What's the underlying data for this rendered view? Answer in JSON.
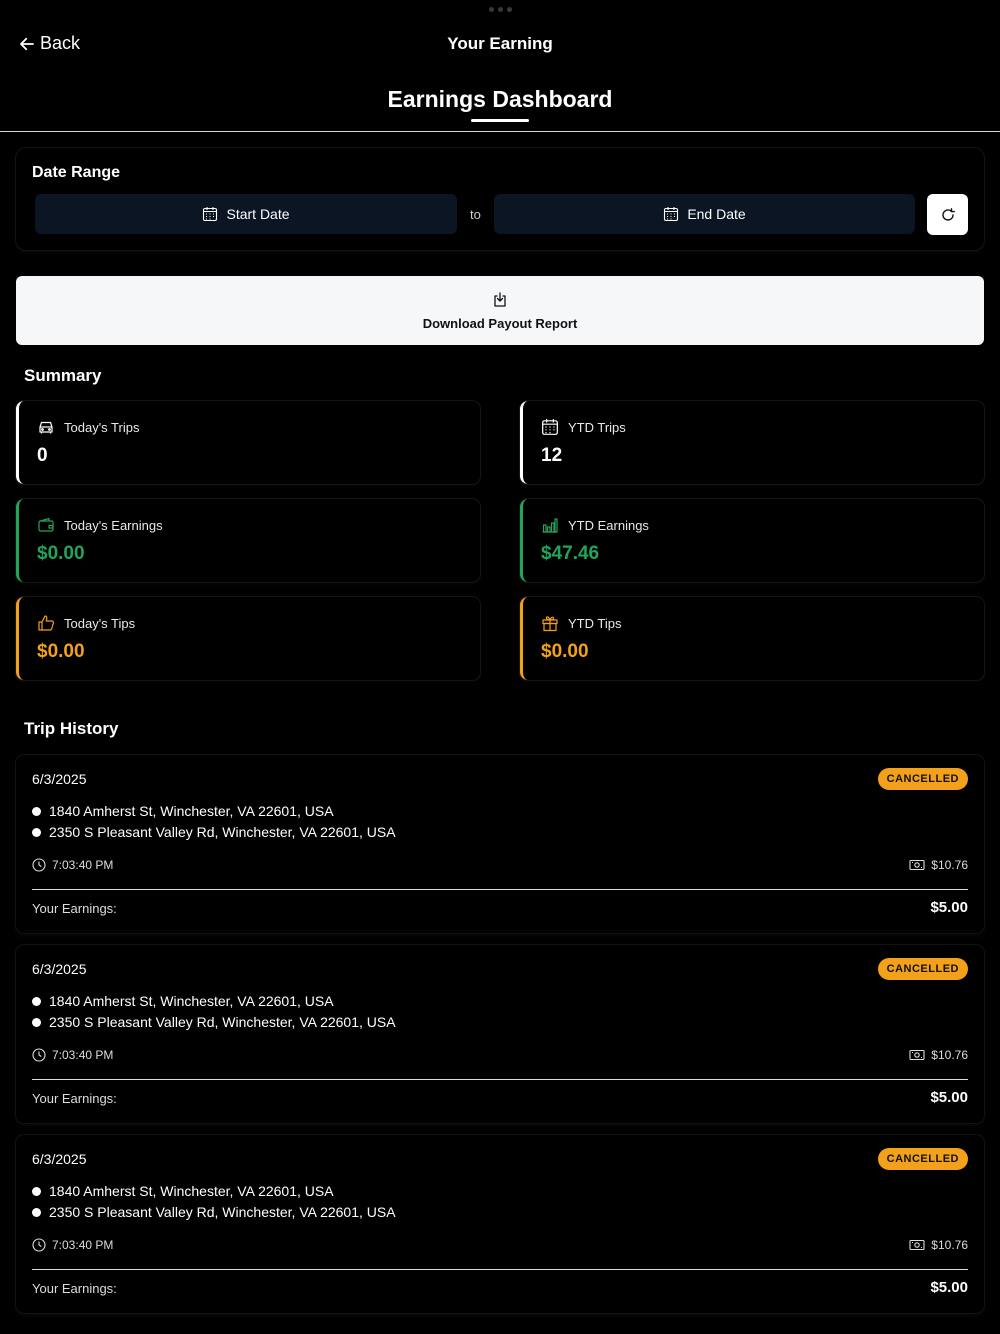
{
  "nav": {
    "back_label": "Back",
    "title": "Your Earning"
  },
  "tab": {
    "title": "Earnings Dashboard"
  },
  "date_range": {
    "label": "Date Range",
    "start_label": "Start Date",
    "to_label": "to",
    "end_label": "End Date"
  },
  "download": {
    "label": "Download Payout Report"
  },
  "summary": {
    "title": "Summary",
    "cards": [
      {
        "label": "Today's Trips",
        "value": "0",
        "icon": "car-icon"
      },
      {
        "label": "YTD Trips",
        "value": "12",
        "icon": "calendar-icon"
      },
      {
        "label": "Today's Earnings",
        "value": "$0.00",
        "icon": "wallet-icon"
      },
      {
        "label": "YTD Earnings",
        "value": "$47.46",
        "icon": "bar-chart-icon"
      },
      {
        "label": "Today's Tips",
        "value": "$0.00",
        "icon": "thumbs-up-icon"
      },
      {
        "label": "YTD Tips",
        "value": "$0.00",
        "icon": "gift-icon"
      }
    ]
  },
  "trip_history": {
    "title": "Trip History",
    "trips": [
      {
        "date": "6/3/2025",
        "status": "CANCELLED",
        "pickup": "1840 Amherst St, Winchester, VA 22601, USA",
        "dropoff": "2350 S Pleasant Valley Rd, Winchester, VA 22601, USA",
        "time": "7:03:40 PM",
        "fare": "$10.76",
        "earnings_label": "Your Earnings:",
        "earnings": "$5.00"
      },
      {
        "date": "6/3/2025",
        "status": "CANCELLED",
        "pickup": "1840 Amherst St, Winchester, VA 22601, USA",
        "dropoff": "2350 S Pleasant Valley Rd, Winchester, VA 22601, USA",
        "time": "7:03:40 PM",
        "fare": "$10.76",
        "earnings_label": "Your Earnings:",
        "earnings": "$5.00"
      },
      {
        "date": "6/3/2025",
        "status": "CANCELLED",
        "pickup": "1840 Amherst St, Winchester, VA 22601, USA",
        "dropoff": "2350 S Pleasant Valley Rd, Winchester, VA 22601, USA",
        "time": "7:03:40 PM",
        "fare": "$10.76",
        "earnings_label": "Your Earnings:",
        "earnings": "$5.00"
      }
    ]
  },
  "colors": {
    "accent_green": "#22a55a",
    "accent_orange": "#f3a11b",
    "date_button_bg": "#0b1524"
  }
}
